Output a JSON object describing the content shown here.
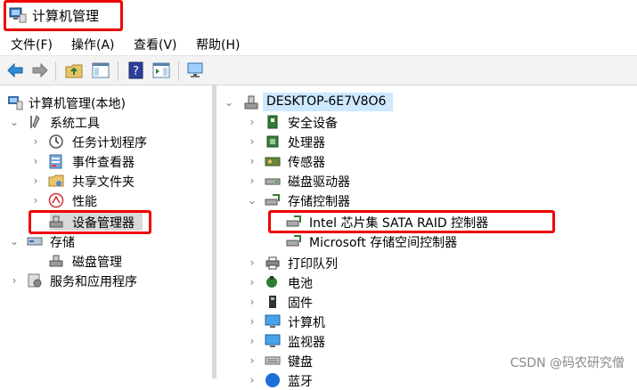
{
  "window": {
    "title": "计算机管理"
  },
  "menu": [
    "文件(F)",
    "操作(A)",
    "查看(V)",
    "帮助(H)"
  ],
  "toolbar": {
    "buttons": [
      "back-arrow-icon",
      "forward-arrow-icon",
      "folder-up-icon",
      "show-hide-console-tree-icon",
      "help-icon",
      "show-action-pane-icon",
      "monitor-icon"
    ]
  },
  "left_tree": {
    "root": "计算机管理(本地)",
    "system_tools": "系统工具",
    "task_scheduler": "任务计划程序",
    "event_viewer": "事件查看器",
    "shared_folders": "共享文件夹",
    "performance": "性能",
    "device_manager": "设备管理器",
    "storage": "存储",
    "disk_management": "磁盘管理",
    "services_apps": "服务和应用程序"
  },
  "right_tree": {
    "computer": "DESKTOP-6E7V8O6",
    "items": [
      "安全设备",
      "处理器",
      "传感器",
      "磁盘驱动器",
      "存储控制器"
    ],
    "storage_children": [
      "Intel 芯片集 SATA RAID 控制器",
      "Microsoft 存储空间控制器"
    ],
    "items_after": [
      "打印队列",
      "电池",
      "固件",
      "计算机",
      "监视器",
      "键盘",
      "蓝牙"
    ]
  },
  "colors": {
    "highlight_red": "#e00000",
    "selection_gray": "#d9d9d9",
    "selection_blue": "#cde8ff"
  },
  "watermark": "CSDN @码农研究僧"
}
